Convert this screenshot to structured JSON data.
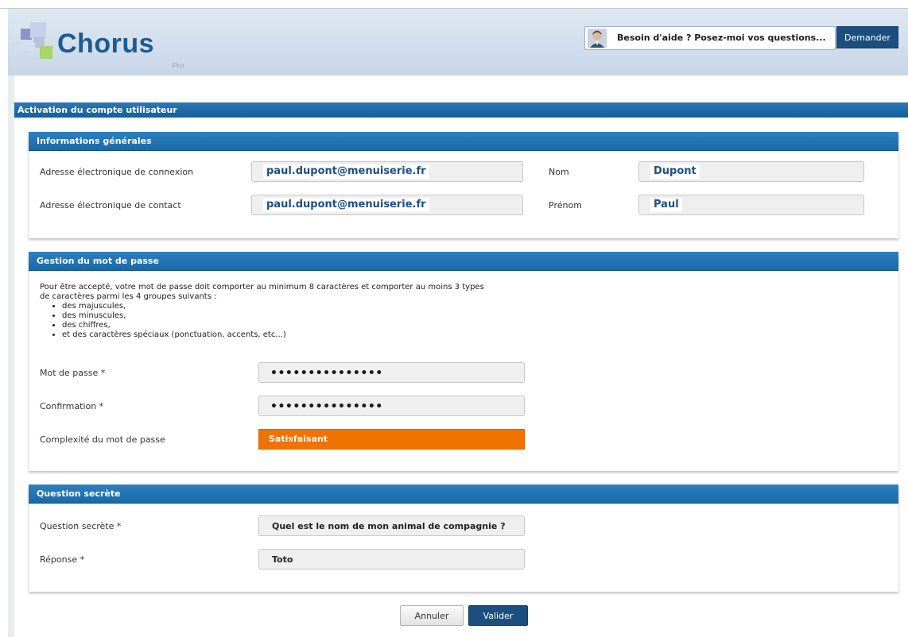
{
  "header": {
    "logo_text": "Chorus",
    "logo_sub": "Pro",
    "help_text": "Besoin d'aide ? Posez-moi vos questions...",
    "ask_button": "Demander"
  },
  "page_title": "Activation du compte utilisateur",
  "general": {
    "title": "Informations générales",
    "login_email_label": "Adresse électronique de connexion",
    "login_email_value": "paul.dupont@menuiserie.fr",
    "contact_email_label": "Adresse électronique de contact",
    "contact_email_value": "paul.dupont@menuiserie.fr",
    "last_name_label": "Nom",
    "last_name_value": "Dupont",
    "first_name_label": "Prénom",
    "first_name_value": "Paul"
  },
  "password": {
    "title": "Gestion du mot de passe",
    "rules_intro": "Pour être accepté, votre mot de passe doit comporter au minimum 8 caractères et comporter au moins 3 types de caractères parmi les 4 groupes suivants :",
    "rules": [
      "des majuscules,",
      "des minuscules,",
      "des chiffres,",
      "et des caractères spéciaux (ponctuation, accents, etc...)"
    ],
    "password_label": "Mot de passe",
    "password_mask": "•••••••••••••••",
    "confirm_label": "Confirmation",
    "confirm_mask": "•••••••••••••••",
    "required_mark": "*",
    "complexity_label": "Complexité du mot de passe",
    "complexity_value": "Satisfaisant",
    "complexity_color": "#f07300"
  },
  "secret": {
    "title": "Question secrète",
    "question_label": "Question secrète",
    "question_value": "Quel est le nom de mon animal de compagnie ?",
    "answer_label": "Réponse",
    "answer_value": "Toto"
  },
  "actions": {
    "cancel": "Annuler",
    "submit": "Valider"
  }
}
